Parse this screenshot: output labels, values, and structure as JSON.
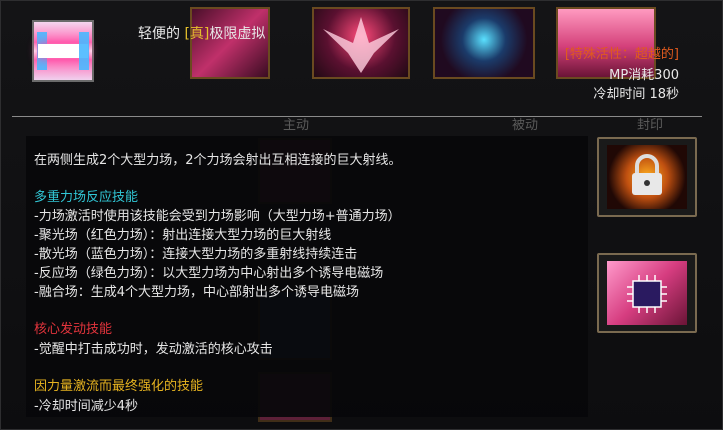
{
  "skill": {
    "name_prefix": "轻便的",
    "name_tag": "[真]",
    "name_suffix": "极限虚拟",
    "special_label": "[特殊活性：超越的]",
    "mp_cost": "MP消耗300",
    "cooldown": "冷却时间 18秒"
  },
  "background_tabs": {
    "active": "主动",
    "passive": "被动",
    "seal": "封印"
  },
  "tooltip": {
    "intro": "在两侧生成2个大型力场，2个力场会射出互相连接的巨大射线。",
    "section1": {
      "title": "多重力场反应技能",
      "lines": [
        "-力场激活时使用该技能会受到力场影响（大型力场+普通力场）",
        "-聚光场（红色力场）：射出连接大型力场的巨大射线",
        "-散光场（蓝色力场）：连接大型力场的多重射线持续连击",
        "-反应场（绿色力场）：以大型力场为中心射出多个诱导电磁场",
        "-融合场：生成4个大型力场，中心部射出多个诱导电磁场"
      ]
    },
    "section2": {
      "title": "核心发动技能",
      "lines": [
        "-觉醒中打击成功时，发动激活的核心攻击"
      ]
    },
    "section3": {
      "title": "因力量激流而最终强化的技能",
      "lines": [
        "-冷却时间减少4秒"
      ]
    }
  },
  "colors": {
    "gold": "#e6c02c",
    "orange": "#e05a1e",
    "cyan": "#31c7d6",
    "red": "#e2343c"
  },
  "icons": [
    "skill-beam-icon",
    "lock-icon",
    "chip-icon"
  ]
}
